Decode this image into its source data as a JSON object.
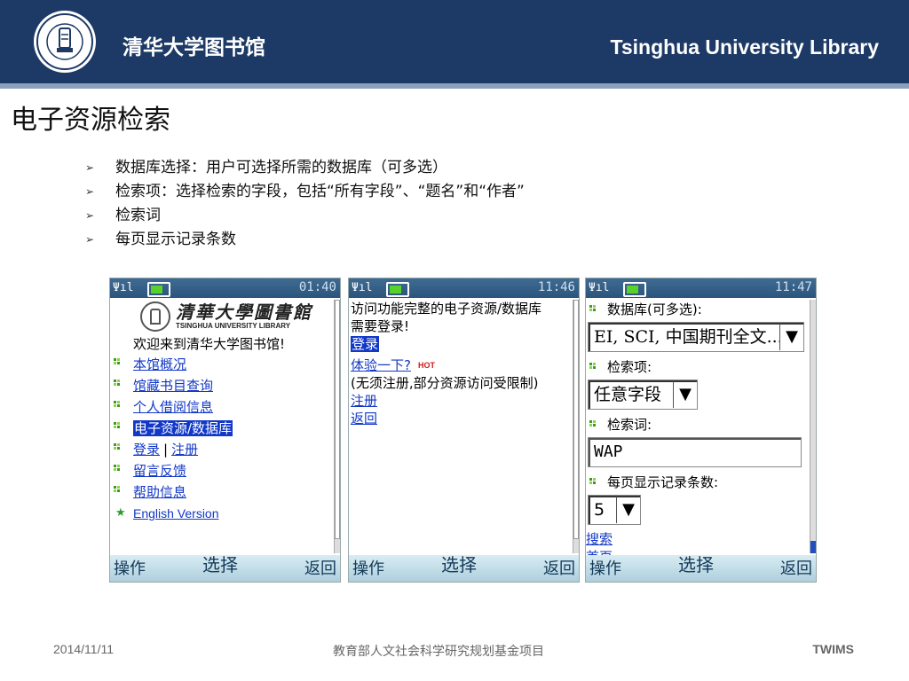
{
  "header": {
    "title_cn": "清华大学图书馆",
    "title_en": "Tsinghua University Library",
    "seal_text": "TSINGHUA UNIVERSITY LIBRARY 1912 清华大学图书馆",
    "bg_color": "#1d3a66"
  },
  "slide_title": "电子资源检索",
  "bullets": [
    "数据库选择：用户可选择所需的数据库（可多选）",
    "检索项：选择检索的字段，包括“所有字段”、“题名”和“作者”",
    "检索词",
    "每页显示记录条数"
  ],
  "phones": [
    {
      "time": "01:40",
      "logo_cn": "清華大學圖書館",
      "logo_en": "TSINGHUA UNIVERSITY LIBRARY",
      "welcome": "欢迎来到清华大学图书馆!",
      "menu": [
        "本馆概况",
        "馆藏书目查询",
        "个人借阅信息",
        "电子资源/数据库"
      ],
      "login": "登录",
      "separator": "|",
      "register": "注册",
      "feedback": "留言反馈",
      "help": "帮助信息",
      "english": "English Version",
      "softkeys": {
        "left": "操作",
        "center": "选择",
        "right": "返回"
      }
    },
    {
      "time": "11:46",
      "line1": "访问功能完整的电子资源/数据库",
      "line2": "需要登录!",
      "login": "登录",
      "trial": "体验一下?",
      "hot": "HOT",
      "note": "(无须注册,部分资源访问受限制)",
      "register": "注册",
      "back": "返回",
      "softkeys": {
        "left": "操作",
        "center": "选择",
        "right": "返回"
      }
    },
    {
      "time": "11:47",
      "db_label": "数据库(可多选):",
      "db_value": "EI, SCI, 中国期刊全文...",
      "field_label": "检索项:",
      "field_value": "任意字段",
      "term_label": "检索词:",
      "term_value": "WAP",
      "per_page_label": "每页显示记录条数:",
      "per_page_value": "5",
      "search": "搜索",
      "home": "首页",
      "softkeys": {
        "left": "操作",
        "center": "选择",
        "right": "返回"
      }
    }
  ],
  "footer": {
    "date": "2014/11/11",
    "center": "教育部人文社会科学研究规划基金项目",
    "right": "TWIMS"
  }
}
